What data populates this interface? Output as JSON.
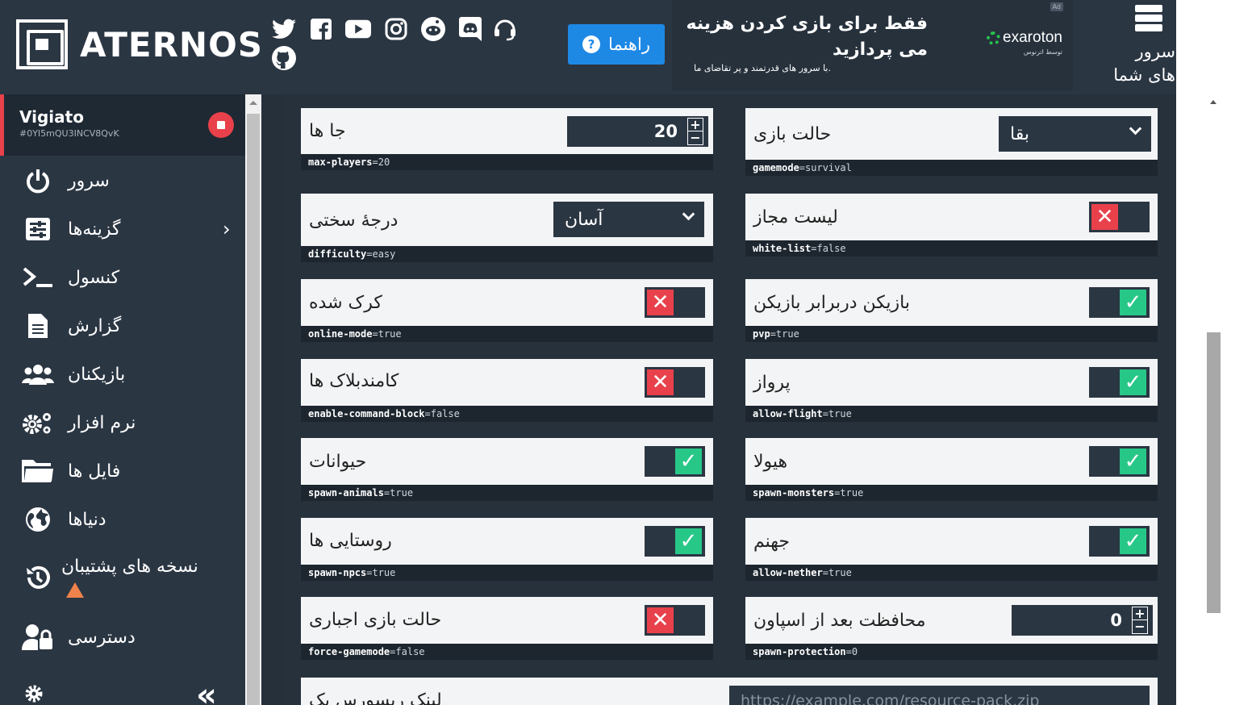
{
  "header": {
    "brand": "ATERNOS",
    "social_icons": [
      "twitter-icon",
      "facebook-icon",
      "youtube-icon",
      "instagram-icon",
      "reddit-icon",
      "discord-icon",
      "support-headset-icon",
      "github-icon"
    ],
    "help_label": "راهنما",
    "ad": {
      "badge": "Ad",
      "title": "فقط برای بازی کردن هزینه می پردازید",
      "subtitle": "با سرور های قدرتمند و پر تقاضای ما.",
      "brand": "exaroton",
      "brand_by": "توسط اترنوس"
    },
    "servers_label": "سرور های شما"
  },
  "sidebar": {
    "user_name": "Vigiato",
    "user_id": "#0YI5mQU3INCV8QvK",
    "items": [
      {
        "label": "سرور"
      },
      {
        "label": "گزینه‌ها"
      },
      {
        "label": "کنسول"
      },
      {
        "label": "گزارش"
      },
      {
        "label": "بازیکنان"
      },
      {
        "label": "نرم افزار"
      },
      {
        "label": "فایل ها"
      },
      {
        "label": "دنیاها"
      },
      {
        "label": "نسخه های پشتیبان"
      },
      {
        "label": "دسترسی"
      }
    ]
  },
  "options": {
    "max_players": {
      "label": "جا ها",
      "key": "max-players",
      "value": "20"
    },
    "gamemode": {
      "label": "حالت بازی",
      "key": "gamemode",
      "value": "survival",
      "selected": "بقا"
    },
    "difficulty": {
      "label": "درجهٔ سختی",
      "key": "difficulty",
      "value": "easy",
      "selected": "آسان"
    },
    "white_list": {
      "label": "لیست مجاز",
      "key": "white-list",
      "value": "false"
    },
    "online_mode": {
      "label": "کرک شده",
      "key": "online-mode",
      "value": "true"
    },
    "pvp": {
      "label": "بازیکن دربرابر بازیکن",
      "key": "pvp",
      "value": "true"
    },
    "command_block": {
      "label": "کامندبلاک ها",
      "key": "enable-command-block",
      "value": "false"
    },
    "allow_flight": {
      "label": "پرواز",
      "key": "allow-flight",
      "value": "true"
    },
    "spawn_animals": {
      "label": "حیوانات",
      "key": "spawn-animals",
      "value": "true"
    },
    "spawn_monsters": {
      "label": "هیولا",
      "key": "spawn-monsters",
      "value": "true"
    },
    "spawn_npcs": {
      "label": "روستایی ها",
      "key": "spawn-npcs",
      "value": "true"
    },
    "allow_nether": {
      "label": "جهنم",
      "key": "allow-nether",
      "value": "true"
    },
    "force_gamemode": {
      "label": "حالت بازی اجباری",
      "key": "force-gamemode",
      "value": "false"
    },
    "spawn_protection": {
      "label": "محافظت بعد از اسپاون",
      "key": "spawn-protection",
      "value": "0"
    },
    "resource_pack": {
      "label": "لینک ریسورس پک",
      "placeholder": "https://example.com/resource-pack.zip"
    }
  }
}
